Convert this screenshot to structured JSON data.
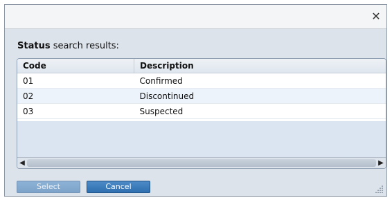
{
  "dialog": {
    "close_glyph": "✕",
    "heading_bold": "Status",
    "heading_rest": " search results:"
  },
  "table": {
    "columns": [
      "Code",
      "Description"
    ],
    "rows": [
      {
        "code": "01",
        "description": "Confirmed"
      },
      {
        "code": "02",
        "description": "Discontinued"
      },
      {
        "code": "03",
        "description": "Suspected"
      }
    ]
  },
  "buttons": {
    "select_label": "Select",
    "cancel_label": "Cancel"
  }
}
